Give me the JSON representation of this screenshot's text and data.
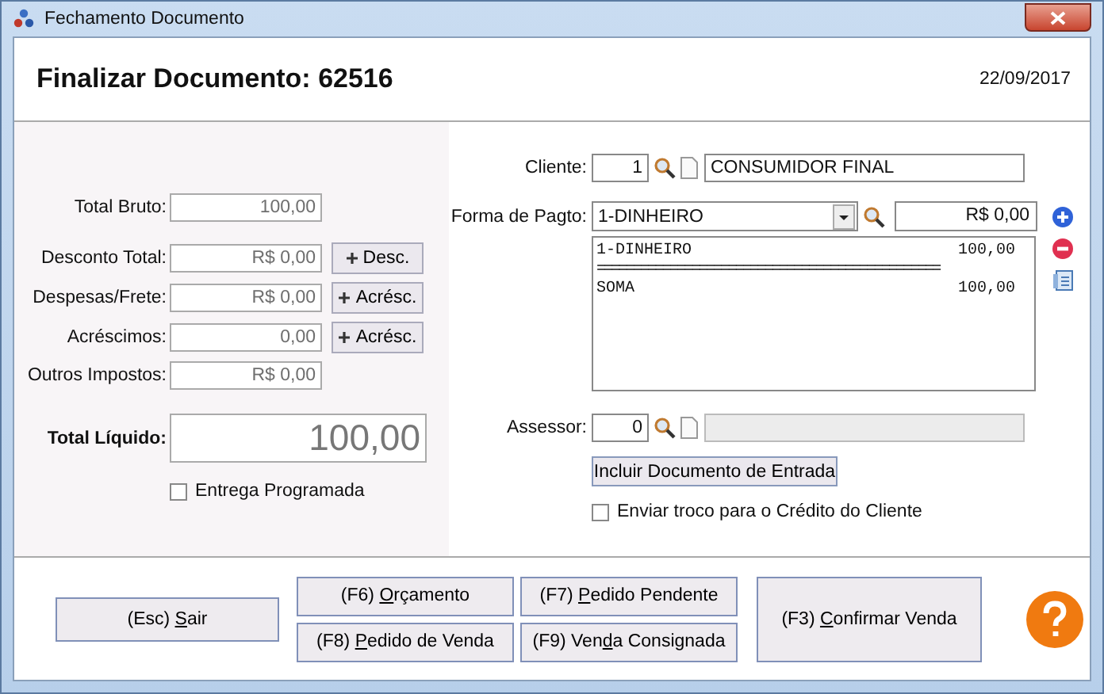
{
  "window": {
    "title": "Fechamento Documento"
  },
  "header": {
    "title": "Finalizar Documento: 62516",
    "date": "22/09/2017"
  },
  "totals": [
    {
      "label": "Total Bruto:",
      "value": "100,00"
    },
    {
      "label": "Desconto Total:",
      "value": "R$ 0,00",
      "button": "Desc."
    },
    {
      "label": "Despesas/Frete:",
      "value": "R$ 0,00",
      "button": "Acrésc."
    },
    {
      "label": "Acréscimos:",
      "value": "0,00",
      "button": "Acrésc."
    },
    {
      "label": "Outros Impostos:",
      "value": "R$ 0,00"
    }
  ],
  "total_liquido": {
    "label": "Total Líquido:",
    "value": "100,00"
  },
  "entrega": {
    "label": "Entrega Programada",
    "checked": false
  },
  "cliente": {
    "label": "Cliente:",
    "code": "1",
    "name": "CONSUMIDOR FINAL"
  },
  "forma_pagto": {
    "label": "Forma de Pagto:",
    "value": "1-DINHEIRO",
    "amount": "R$ 0,00"
  },
  "payment_list": [
    {
      "kind": "row",
      "name": "1-DINHEIRO",
      "amount": "100,00"
    },
    {
      "kind": "separator",
      "text": "==============================================="
    },
    {
      "kind": "row",
      "name": "SOMA",
      "amount": "100,00"
    }
  ],
  "assessor": {
    "label": "Assessor:",
    "code": "0"
  },
  "include_button": "Incluir Documento de Entrada",
  "troco": {
    "label": "Enviar troco para o Crédito do Cliente",
    "checked": false
  },
  "exit_button": {
    "before": "(Esc) ",
    "key": "S",
    "after": "air"
  },
  "action_buttons": [
    {
      "before": "(F6) ",
      "key": "O",
      "after": "rçamento"
    },
    {
      "before": "(F7) ",
      "key": "P",
      "after": "edido Pendente"
    },
    {
      "before": "(F8) ",
      "key": "P",
      "after": "edido de Venda"
    },
    {
      "before": "(F9) Ven",
      "key": "d",
      "after": "a Consignada"
    }
  ],
  "confirm_button": {
    "before": "(F3) ",
    "key": "C",
    "after": "onfirmar Venda"
  }
}
